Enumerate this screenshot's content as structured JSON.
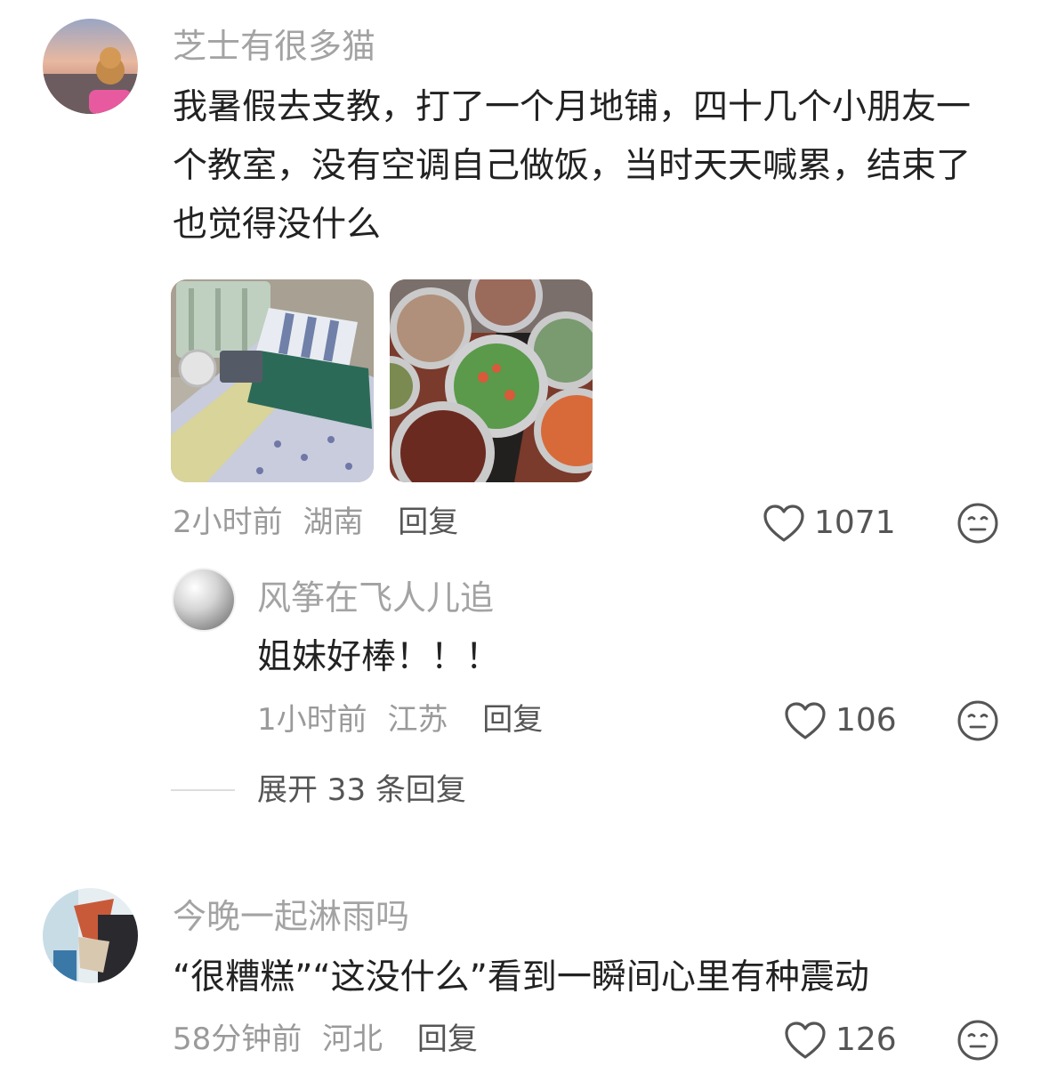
{
  "comments": [
    {
      "username": "芝士有很多猫",
      "text": "我暑假去支教，打了一个月地铺，四十几个小朋友一个教室，没有空调自己做饭，当时天天喊累，结束了也觉得没什么",
      "time": "2小时前",
      "location": "湖南",
      "reply_label": "回复",
      "likes": "1071",
      "photos": [
        "floor-bed-photo",
        "dishes-photo"
      ],
      "reply": {
        "username": "风筝在飞人儿追",
        "text": "姐妹好棒！！！",
        "time": "1小时前",
        "location": "江苏",
        "reply_label": "回复",
        "likes": "106"
      },
      "expand_label": "展开 33 条回复"
    },
    {
      "username": "今晚一起淋雨吗",
      "text": "“很糟糕”“这没什么”看到一瞬间心里有种震动",
      "time": "58分钟前",
      "location": "河北",
      "reply_label": "回复",
      "likes": "126"
    }
  ],
  "icons": {
    "like": "heart-outline-icon",
    "react": "meh-face-icon"
  },
  "colors": {
    "username": "#a3a3a3",
    "text": "#222222",
    "meta": "#9a9a9a",
    "action": "#555555"
  }
}
